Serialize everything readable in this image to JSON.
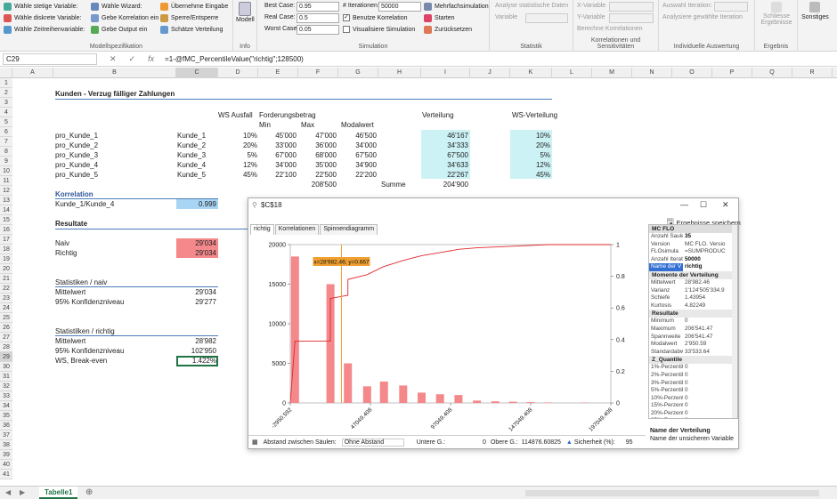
{
  "ribbon": {
    "modellspezifikation": {
      "label": "Modellspezifikation",
      "items": [
        "Wähle stetige Variable:",
        "Wähle diskrete Variable:",
        "Wähle Zeitreihenvariable:",
        "Wähle Wizard:",
        "Gebe Korrelation ein",
        "Gebe Output ein",
        "Übernehme Eingabe",
        "Sperre/Entsperre",
        "Schätze Verteilung"
      ]
    },
    "info": {
      "label": "Info",
      "button": "Modell"
    },
    "simulation": {
      "label": "Simulation",
      "best_case_label": "Best Case:",
      "best_case_value": "0.95",
      "real_case_label": "Real Case:",
      "real_case_value": "0.5",
      "worst_case_label": "Worst Case:",
      "worst_case_value": "0.05",
      "iterations_label": "# Iterationen:",
      "iterations_value": "50000",
      "benutze": "Benutze Korrelation",
      "visualisiere": "Visualisiere Simulation",
      "mehrfach": "Mehrfachsimulation",
      "starten": "Starten",
      "zuruecksetzen": "Zurücksetzen"
    },
    "statistik": {
      "label": "Statistik",
      "analyse": "Analyse statistische Daten",
      "variable": "Variable"
    },
    "korrelationen": {
      "label": "Korrelationen und Sensitivitäten",
      "x": "X-Variable",
      "y": "Y-Variable",
      "berechne": "Berechne Korrelationen"
    },
    "auswertung": {
      "label": "Individuelle Auswertung",
      "iteration": "Auswahl Iteration:",
      "analysiere": "Analysiere gewählte Iteration"
    },
    "ergebnis": {
      "label": "Ergebnis",
      "schliesse": "Schliesse Ergebnisse"
    },
    "sonstiges": "Sonstiges"
  },
  "formula_bar": {
    "name_box": "C29",
    "fx": "fx",
    "formula": "=1-@fMC_PercentileValue(\"richtig\";128500)"
  },
  "columns": [
    "A",
    "B",
    "C",
    "D",
    "E",
    "F",
    "G",
    "H",
    "I",
    "J",
    "K",
    "L",
    "M",
    "N",
    "O",
    "P",
    "Q",
    "R"
  ],
  "rows": [
    "1",
    "2",
    "3",
    "4",
    "5",
    "6",
    "7",
    "8",
    "9",
    "10",
    "11",
    "12",
    "13",
    "14",
    "15",
    "16",
    "17",
    "18",
    "19",
    "20",
    "21",
    "22",
    "23",
    "24",
    "25",
    "26",
    "27",
    "28",
    "29",
    "30",
    "31",
    "32",
    "33",
    "34",
    "35",
    "36",
    "37",
    "38",
    "39",
    "40",
    "41"
  ],
  "sheet": {
    "title": "Kunden - Verzug fälliger Zahlungen",
    "hdr_ws": "WS Ausfall",
    "hdr_fb": "Forderungsbetrag",
    "hdr_min": "Min",
    "hdr_max": "Max",
    "hdr_modal": "Modalwert",
    "hdr_vert": "Verteilung",
    "hdr_wsvert": "WS-Verteilung",
    "kunden": [
      {
        "a": "pro_Kunde_1",
        "b": "Kunde_1",
        "ws": "10%",
        "min": "45'000",
        "max": "47'000",
        "modal": "46'500",
        "vert": "46'167",
        "wsv": "10%"
      },
      {
        "a": "pro_Kunde_2",
        "b": "Kunde_2",
        "ws": "20%",
        "min": "33'000",
        "max": "36'000",
        "modal": "34'000",
        "vert": "34'333",
        "wsv": "20%"
      },
      {
        "a": "pro_Kunde_3",
        "b": "Kunde_3",
        "ws": "5%",
        "min": "67'000",
        "max": "68'000",
        "modal": "67'500",
        "vert": "67'500",
        "wsv": "5%"
      },
      {
        "a": "pro_Kunde_4",
        "b": "Kunde_4",
        "ws": "12%",
        "min": "34'000",
        "max": "35'000",
        "modal": "34'900",
        "vert": "34'633",
        "wsv": "12%"
      },
      {
        "a": "pro_Kunde_5",
        "b": "Kunde_5",
        "ws": "45%",
        "min": "22'100",
        "max": "22'500",
        "modal": "22'200",
        "vert": "22'267",
        "wsv": "45%"
      }
    ],
    "sum_max": "208'500",
    "summe_label": "Summe",
    "sum_vert": "204'900",
    "korr_title": "Korrelation",
    "korr_label": "Kunde_1/Kunde_4",
    "korr_value": "0.999",
    "res_title": "Resultate",
    "naiv_label": "Naiv",
    "naiv_value": "29'034",
    "richtig_label": "Richtig",
    "richtig_value": "29'034",
    "stat_naiv_title": "Statistiken / naiv",
    "mw1_label": "Mittelwert",
    "mw1_value": "29'034",
    "k1_label": "95% Konfidenzniveau",
    "k1_value": "29'277",
    "stat_richtig_title": "Statistilken / richtig",
    "mw2_label": "Mittelwert",
    "mw2_value": "28'982",
    "k2_label": "95% Konfidenzniveau",
    "k2_value": "102'950",
    "be_label": "WS, Break-even",
    "be_value": "1.422%"
  },
  "window": {
    "title": "$C$18",
    "save": "Ergebnisse speichern",
    "tabs": [
      "richtig",
      "Korrelationen",
      "Spinnendiagramm"
    ],
    "panel": {
      "header": "MC FLO",
      "top_rows": [
        [
          "Anzahl Saule",
          "35"
        ],
        [
          "Version",
          "MC FLO. Versio"
        ],
        [
          "FLOsimula",
          "=SUMPRODUC"
        ],
        [
          "Anzahl Iterati",
          "50000"
        ],
        [
          "Name der V",
          "richtig"
        ]
      ],
      "momente_title": "Momente der Verteilung",
      "momente": [
        [
          "Mittelwert",
          "28'982.46"
        ],
        [
          "Varianz",
          "1'124'505'334.9"
        ],
        [
          "Schiefe",
          "1.43954"
        ],
        [
          "Kurtosis",
          "4.82249"
        ]
      ],
      "resultate_title": "Resultate",
      "resultate": [
        [
          "Minimum",
          "0"
        ],
        [
          "Maximum",
          "206'541.47"
        ],
        [
          "Spannweite",
          "206'541.47"
        ],
        [
          "Modalwert",
          "2'950.59"
        ],
        [
          "Standardabw",
          "33'533.64"
        ]
      ],
      "quantile_title": "Z_Quantile",
      "quantile": [
        [
          "1%-Perzentil",
          "0"
        ],
        [
          "2%-Perzentil",
          "0"
        ],
        [
          "3%-Perzentil",
          "0"
        ],
        [
          "5%-Perzentil",
          "0"
        ],
        [
          "10%-Perzent",
          "0"
        ],
        [
          "15%-Perzent",
          "0"
        ],
        [
          "20%-Perzent",
          "0"
        ],
        [
          "25%-Perzent",
          "0"
        ]
      ]
    },
    "desc_title": "Name der Verteilung",
    "desc_text": "Name der unsicheren Variable",
    "bottom": {
      "abstand_label": "Abstand zwischen Säulen:",
      "abstand_value": "Ohne Abstand",
      "untere_label": "Untere G.:",
      "untere_value": "0",
      "obere_label": "Obere G.:",
      "obere_value": "114876.60825",
      "sicherheit_label": "Sicherheit (%):",
      "sicherheit_value": "95"
    }
  },
  "sheet_tab": "Tabelle1",
  "chart_data": {
    "type": "bar",
    "x_tick_labels": [
      "-2950.592",
      "47049.408",
      "97049.408",
      "147049.408",
      "197049.408"
    ],
    "x_ticks": [
      -2950.592,
      47049.408,
      97049.408,
      147049.408,
      197049.408
    ],
    "xlim": [
      -2950.592,
      197049.408
    ],
    "ylim": [
      0,
      20000
    ],
    "y_ticks": [
      0,
      5000,
      10000,
      15000,
      20000
    ],
    "y2lim": [
      0,
      1
    ],
    "y2_ticks": [
      0,
      0.2,
      0.4,
      0.6,
      0.8,
      1
    ],
    "bins": [
      {
        "x": 0,
        "y": 18500
      },
      {
        "x": 22100,
        "y": 15000
      },
      {
        "x": 33000,
        "y": 5000
      },
      {
        "x": 45000,
        "y": 2100
      },
      {
        "x": 55500,
        "y": 2700
      },
      {
        "x": 67500,
        "y": 2200
      },
      {
        "x": 79000,
        "y": 1300
      },
      {
        "x": 90500,
        "y": 1100
      },
      {
        "x": 102000,
        "y": 1000
      },
      {
        "x": 113500,
        "y": 300
      },
      {
        "x": 125000,
        "y": 200
      },
      {
        "x": 136000,
        "y": 150
      },
      {
        "x": 147000,
        "y": 100
      },
      {
        "x": 158000,
        "y": 60
      },
      {
        "x": 181000,
        "y": 40
      }
    ],
    "cumulative": [
      [
        -2950.592,
        0
      ],
      [
        0,
        0.39
      ],
      [
        10000,
        0.39
      ],
      [
        22000,
        0.39
      ],
      [
        22100,
        0.66
      ],
      [
        33000,
        0.68
      ],
      [
        33000,
        0.78
      ],
      [
        45000,
        0.81
      ],
      [
        55000,
        0.86
      ],
      [
        67500,
        0.9
      ],
      [
        79000,
        0.93
      ],
      [
        90500,
        0.95
      ],
      [
        102000,
        0.97
      ],
      [
        113500,
        0.98
      ],
      [
        136000,
        0.99
      ],
      [
        158000,
        1
      ],
      [
        197049.408,
        1
      ]
    ],
    "marker": {
      "x": 28982.46,
      "label": "x=28'982.46; y=0.667"
    }
  },
  "colors": {
    "bar": "#f4888a",
    "line": "#e0282e",
    "marker": "#f0a030",
    "cyan": "#cdf2f5",
    "blue": "#a9d5f4",
    "red": "#f4888a"
  }
}
